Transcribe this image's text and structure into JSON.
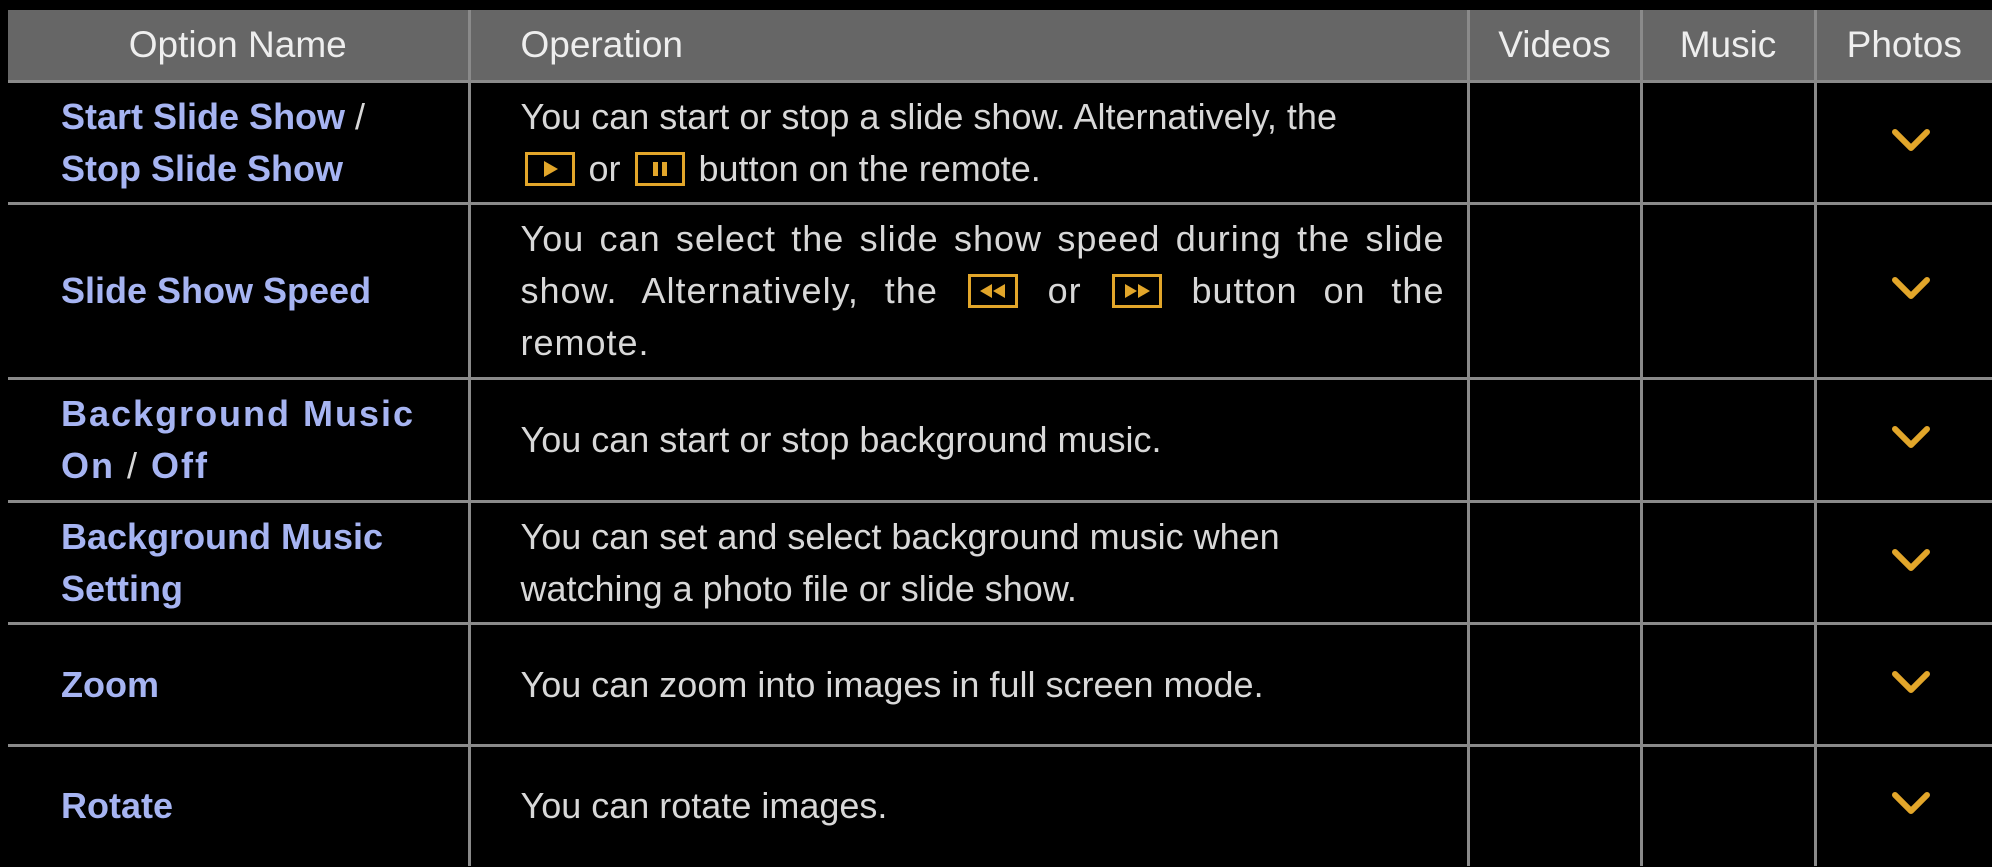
{
  "header": {
    "option_name": "Option Name",
    "operation": "Operation",
    "videos": "Videos",
    "music": "Music",
    "photos": "Photos"
  },
  "rows": [
    {
      "name_a": "Start Slide Show",
      "name_sep": " / ",
      "name_b": "Stop Slide Show",
      "op_text_1": "You can start or stop a slide show. Alternatively, the",
      "op_key_1": "play-key-icon",
      "op_mid": " or ",
      "op_key_2": "pause-key-icon",
      "op_text_2": " button on the remote.",
      "videos": false,
      "music": false,
      "photos": true
    },
    {
      "name": "Slide Show Speed",
      "op_text_1": "You can select the slide show speed during the slide show. Alternatively, the",
      "op_key_1": "rewind-key-icon",
      "op_mid": " or ",
      "op_key_2": "fast-forward-key-icon",
      "op_text_2": " button on the remote.",
      "videos": false,
      "music": false,
      "photos": true
    },
    {
      "name_a": "Background Music",
      "name_b": "On",
      "name_sep": " / ",
      "name_c": "Off",
      "operation": "You can start or stop background music.",
      "videos": false,
      "music": false,
      "photos": true
    },
    {
      "name_a": "Background Music",
      "name_b": "Setting",
      "op_line_1": "You can set and select background music when",
      "op_line_2": "watching a photo file or slide show.",
      "videos": false,
      "music": false,
      "photos": true
    },
    {
      "name": "Zoom",
      "operation": "You can zoom into images in full screen mode.",
      "videos": false,
      "music": false,
      "photos": true
    },
    {
      "name": "Rotate",
      "operation": "You can rotate images.",
      "videos": false,
      "music": false,
      "photos": true
    }
  ],
  "icons": {
    "check": "check-mark-icon"
  },
  "colors": {
    "header_bg": "#666666",
    "option_name": "#a6b4f2",
    "check_mark": "#e2a62a",
    "grid_line": "#8a8a8a"
  }
}
